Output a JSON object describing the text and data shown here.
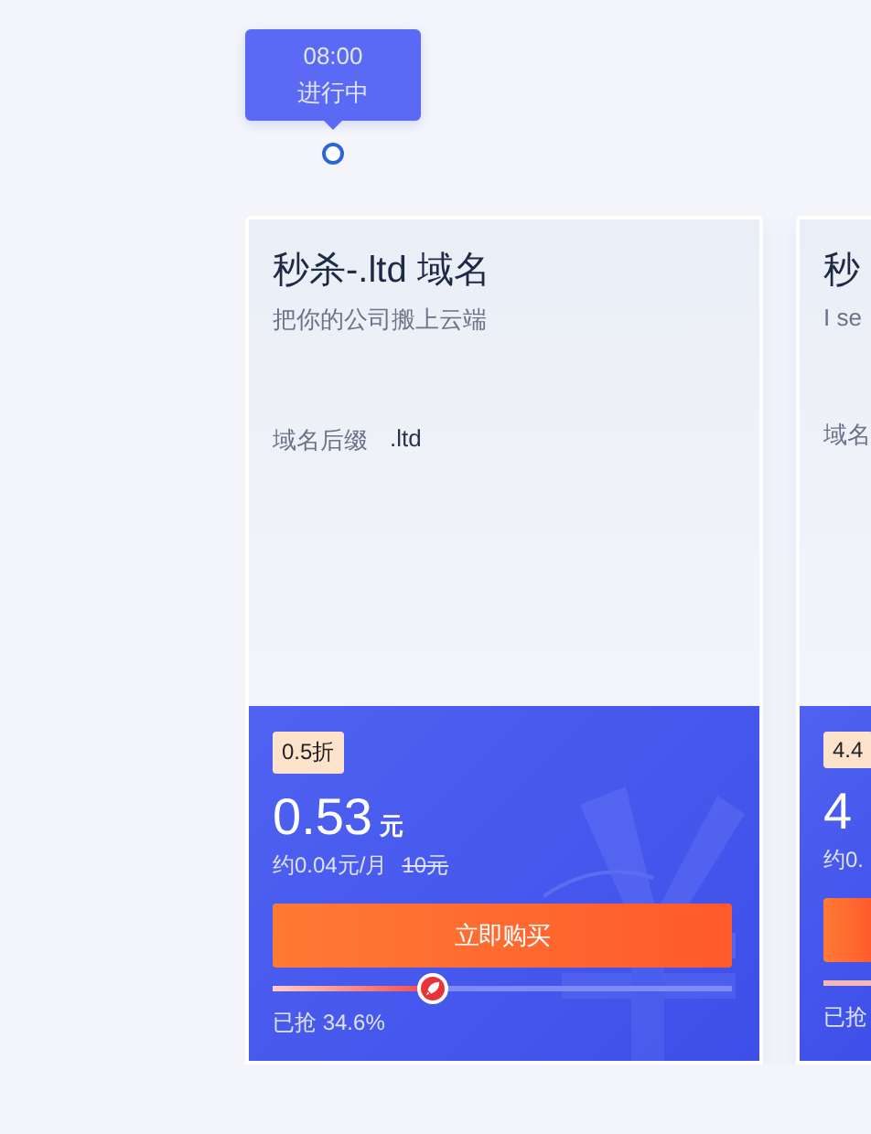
{
  "timeline": {
    "time": "08:00",
    "status": "进行中"
  },
  "cards": [
    {
      "kind": "full",
      "title": "秒杀-.ltd 域名",
      "subtitle": "把你的公司搬上云端",
      "spec_label": "域名后缀",
      "spec_value": ".ltd",
      "discount": "0.5折",
      "price": "0.53",
      "unit": "元",
      "monthly": "约0.04元/月",
      "original_price": "10元",
      "button": "立即购买",
      "level": 0.346,
      "sold": "已抢 34.6%"
    },
    {
      "kind": "partial",
      "title": "秒",
      "subtitle": "I se",
      "spec_label": "域名",
      "discount": "4.4",
      "price": "4",
      "monthly": "约0.",
      "sold": "已抢"
    }
  ]
}
